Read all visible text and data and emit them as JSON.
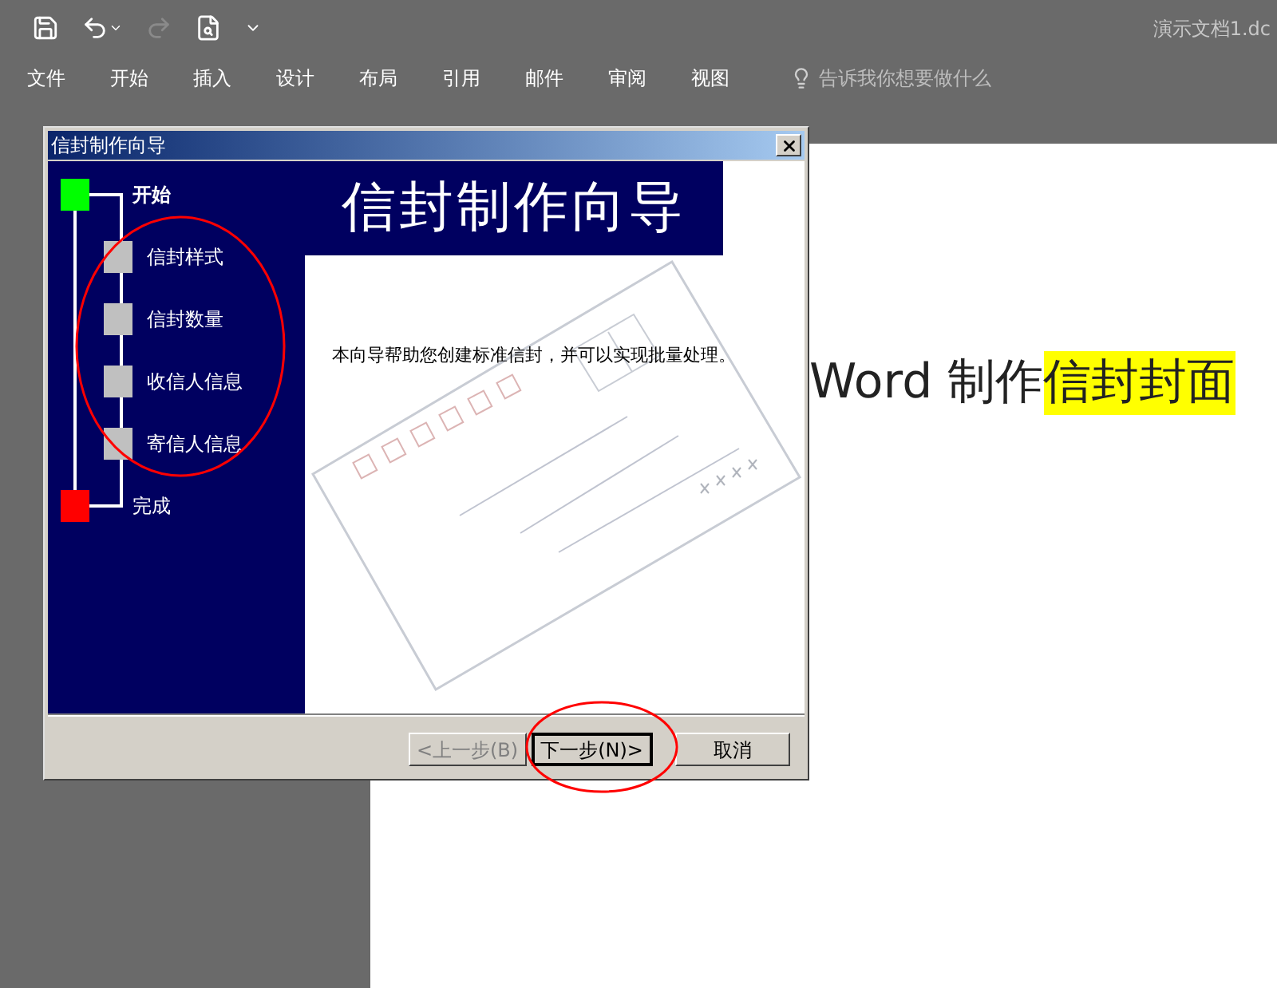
{
  "quick_access": [
    {
      "kind": "save",
      "disabled": false
    },
    {
      "kind": "undo",
      "disabled": false
    },
    {
      "kind": "redo",
      "disabled": true
    },
    {
      "kind": "preview",
      "disabled": false
    },
    {
      "kind": "customize",
      "disabled": false
    }
  ],
  "document_title": "演示文档1.dc",
  "ribbon_tabs": [
    "文件",
    "开始",
    "插入",
    "设计",
    "布局",
    "引用",
    "邮件",
    "审阅",
    "视图"
  ],
  "tell_me": {
    "placeholder": "告诉我你想要做什么"
  },
  "document": {
    "text": "Word 制作",
    "highlighted_text": "信封封面"
  },
  "dialog": {
    "title": "信封制作向导",
    "banner": "信封制作向导",
    "steps": [
      {
        "label": "开始",
        "kind": "start",
        "color": "#00ff00"
      },
      {
        "label": "信封样式",
        "kind": "step",
        "color": "#c0c0c0"
      },
      {
        "label": "信封数量",
        "kind": "step",
        "color": "#c0c0c0"
      },
      {
        "label": "收信人信息",
        "kind": "step",
        "color": "#c0c0c0"
      },
      {
        "label": "寄信人信息",
        "kind": "step",
        "color": "#c0c0c0"
      },
      {
        "label": "完成",
        "kind": "end",
        "color": "#ff0000"
      }
    ],
    "intro": "本向导帮助您创建标准信封，并可以实现批量处理。",
    "buttons": [
      {
        "label": "<上一步(B)",
        "disabled": true,
        "default": false
      },
      {
        "label": "下一步(N)>",
        "disabled": false,
        "default": true
      },
      {
        "label": "取消",
        "disabled": false,
        "default": false
      }
    ]
  }
}
